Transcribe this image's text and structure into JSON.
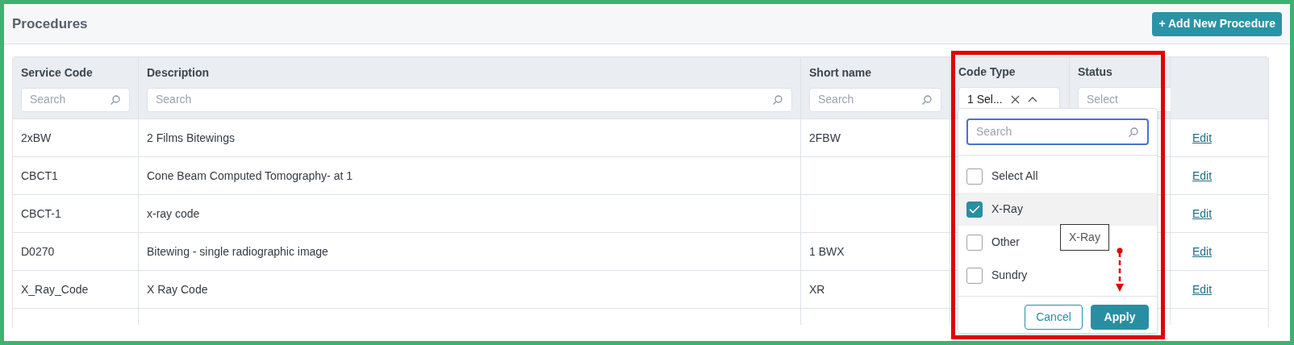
{
  "page": {
    "title": "Procedures",
    "add_button": "+ Add New Procedure"
  },
  "table": {
    "columns": [
      {
        "label": "Service Code",
        "filter": {
          "kind": "search",
          "placeholder": "Search"
        }
      },
      {
        "label": "Description",
        "filter": {
          "kind": "search",
          "placeholder": "Search"
        }
      },
      {
        "label": "Short name",
        "filter": {
          "kind": "search",
          "placeholder": "Search"
        }
      },
      {
        "label": "Code Type",
        "filter": {
          "kind": "multiselect",
          "value": "1 Sel...",
          "expanded": true
        }
      },
      {
        "label": "Status",
        "filter": {
          "kind": "select",
          "placeholder": "Select"
        }
      },
      {
        "filter": {
          "kind": "none"
        }
      }
    ],
    "rows": [
      {
        "service_code": "2xBW",
        "description": "2 Films Bitewings",
        "short_name": "2FBW",
        "action": "Edit"
      },
      {
        "service_code": "CBCT1",
        "description": "Cone Beam Computed Tomography- at 1",
        "action": "Edit"
      },
      {
        "service_code": "CBCT-1",
        "description": "x-ray code",
        "action": "Edit"
      },
      {
        "service_code": "D0270",
        "description": "Bitewing - single radiographic image",
        "short_name": "1 BWX",
        "action": "Edit"
      },
      {
        "service_code": "X_Ray_Code",
        "description": "X Ray Code",
        "short_name": "XR",
        "action": "Edit"
      }
    ]
  },
  "code_type_dropdown": {
    "search_placeholder": "Search",
    "options": [
      {
        "label": "Select All",
        "checked": false,
        "highlighted": false
      },
      {
        "label": "X-Ray",
        "checked": true,
        "highlighted": true
      },
      {
        "label": "Other",
        "checked": false,
        "highlighted": false
      },
      {
        "label": "Sundry",
        "checked": false,
        "highlighted": false
      }
    ],
    "tooltip": "X-Ray",
    "buttons": [
      {
        "label": "Cancel",
        "kind": "secondary"
      },
      {
        "label": "Apply",
        "kind": "primary"
      }
    ]
  }
}
